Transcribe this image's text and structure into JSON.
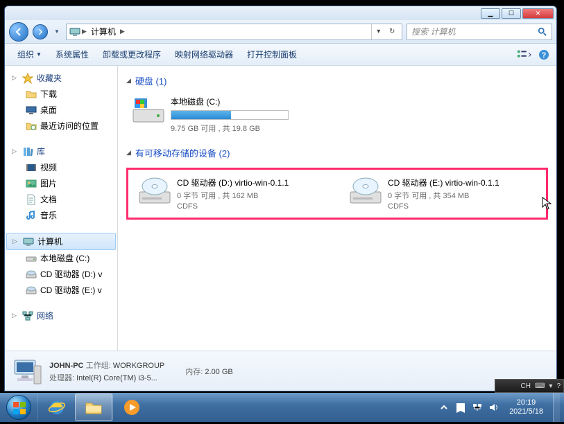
{
  "window": {
    "breadcrumb": {
      "icon": "computer",
      "seg1": "计算机"
    },
    "search_placeholder": "搜索 计算机"
  },
  "toolbar": {
    "organize": "组织",
    "sys_props": "系统属性",
    "uninstall": "卸载或更改程序",
    "map_drive": "映射网络驱动器",
    "control_panel": "打开控制面板"
  },
  "sidebar": {
    "favorites": {
      "label": "收藏夹",
      "items": [
        "下载",
        "桌面",
        "最近访问的位置"
      ]
    },
    "libraries": {
      "label": "库",
      "items": [
        "视频",
        "图片",
        "文档",
        "音乐"
      ]
    },
    "computer": {
      "label": "计算机",
      "items": [
        "本地磁盘 (C:)",
        "CD 驱动器 (D:) v",
        "CD 驱动器 (E:) v"
      ]
    },
    "network": {
      "label": "网络"
    }
  },
  "main": {
    "hdd_section": "硬盘 (1)",
    "removable_section": "有可移动存储的设备 (2)",
    "local_disk": {
      "title": "本地磁盘 (C:)",
      "sub": "9.75 GB 可用 , 共 19.8 GB",
      "fill_pct": 51
    },
    "cd_d": {
      "title": "CD 驱动器 (D:) virtio-win-0.1.1",
      "sub": "0 字节 可用 , 共 162 MB",
      "fs": "CDFS"
    },
    "cd_e": {
      "title": "CD 驱动器 (E:) virtio-win-0.1.1",
      "sub": "0 字节 可用 , 共 354 MB",
      "fs": "CDFS"
    }
  },
  "details": {
    "name": "JOHN-PC",
    "workgroup_k": "工作组:",
    "workgroup_v": "WORKGROUP",
    "cpu_k": "处理器:",
    "cpu_v": "Intel(R) Core(TM) i3-5...",
    "mem_k": "内存:",
    "mem_v": "2.00 GB"
  },
  "langbar": {
    "text": "CH"
  },
  "tray": {
    "time": "20:19",
    "date": "2021/5/18"
  }
}
